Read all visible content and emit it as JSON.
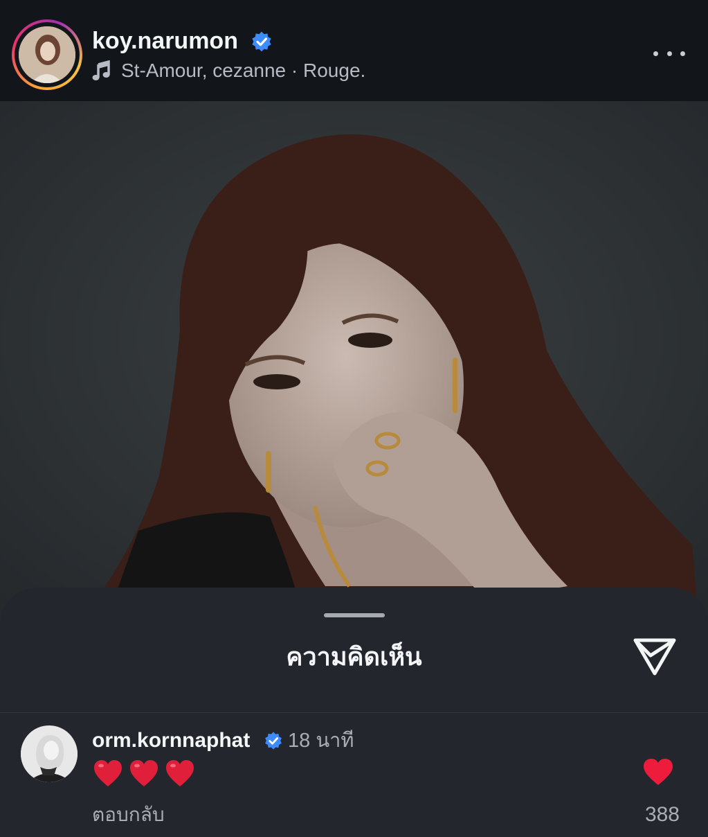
{
  "post": {
    "username": "koy.narumon",
    "verified": true,
    "music": "St-Amour, cezanne · Rouge.",
    "icons": {
      "verified": "verified-badge-icon",
      "music": "music-note-icon",
      "more": "more-options-icon"
    }
  },
  "sheet": {
    "title": "ความคิดเห็น",
    "share_icon": "send-icon"
  },
  "comments": [
    {
      "username": "orm.kornnaphat",
      "verified": true,
      "time": "18 นาที",
      "text_emoji": [
        "red-heart",
        "red-heart",
        "red-heart"
      ],
      "reply_label": "ตอบกลับ",
      "likes": "388",
      "liked": true
    }
  ],
  "colors": {
    "verified_blue": "#3d8bfd",
    "heart_red": "#ed1c3c",
    "sheet_bg": "#23262c"
  }
}
